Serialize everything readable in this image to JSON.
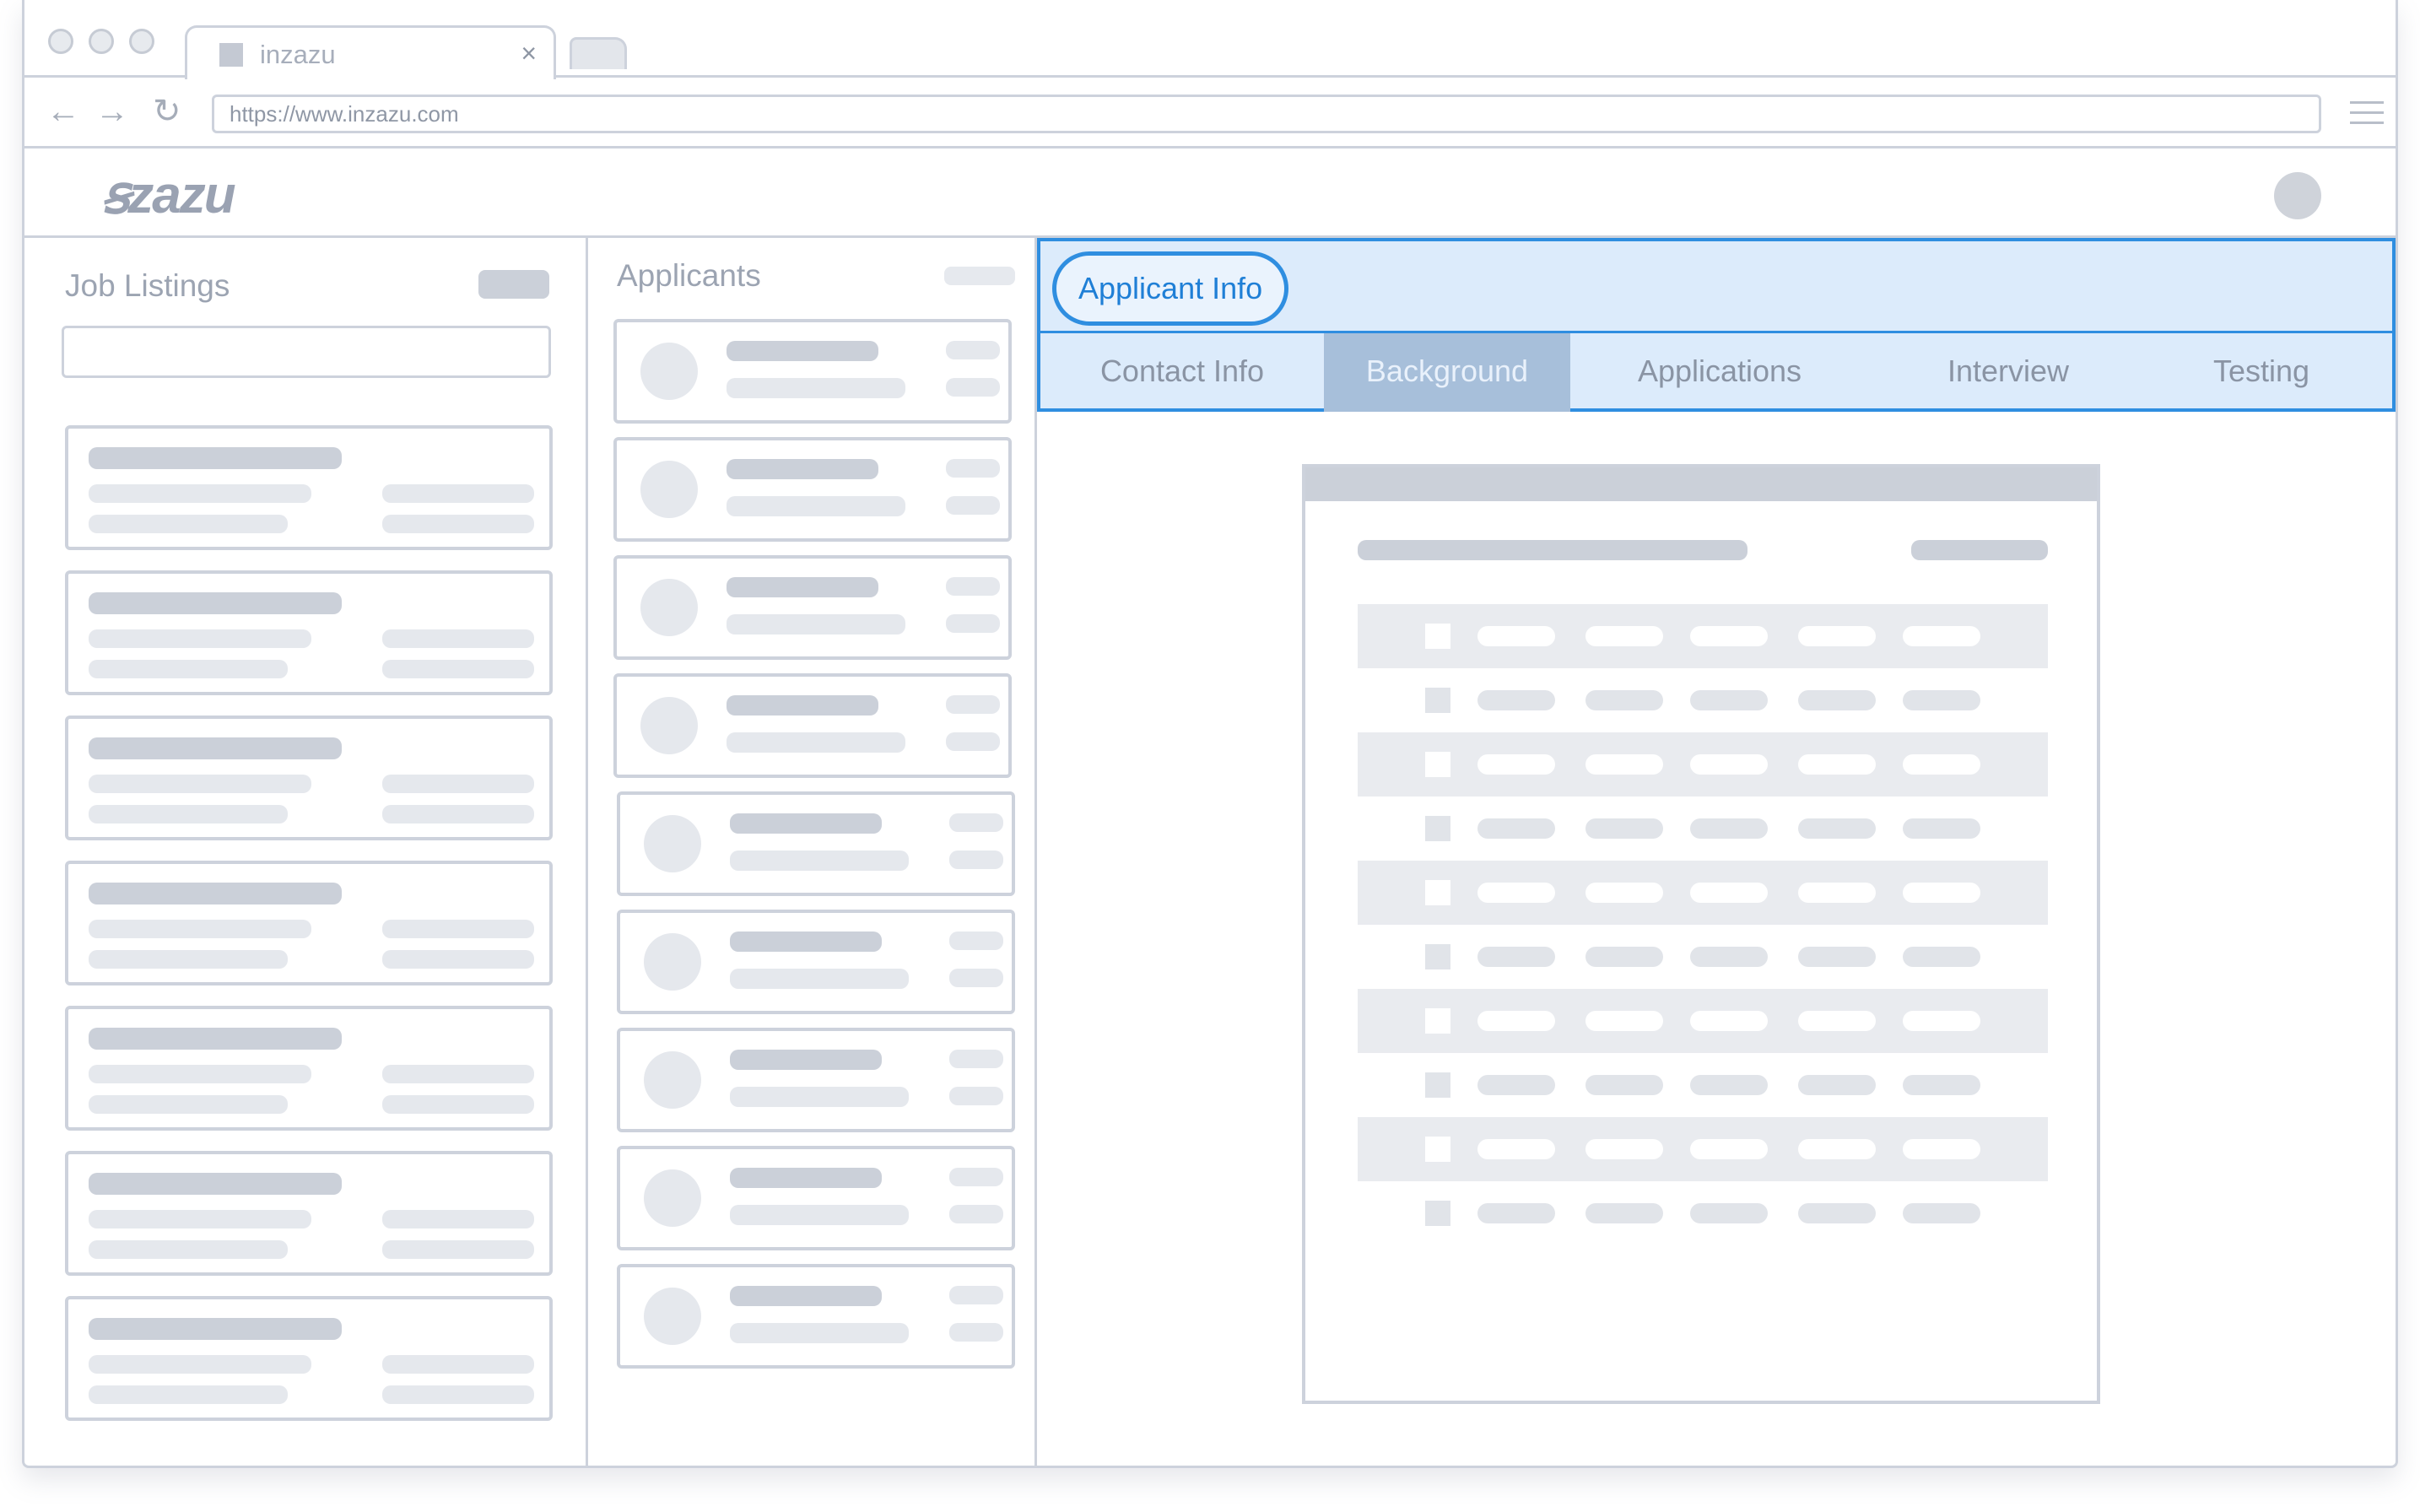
{
  "browser": {
    "tab_title": "inzazu",
    "tab_close": "×",
    "url": "https://www.inzazu.com",
    "back_glyph": "←",
    "forward_glyph": "→",
    "reload_glyph": "↻"
  },
  "app": {
    "logo": "ꞩzazu"
  },
  "jobs": {
    "title": "Job Listings",
    "card_count": 7
  },
  "applicants": {
    "title": "Applicants",
    "card_count": 9
  },
  "detail": {
    "section_button": "Applicant Info",
    "tabs": [
      {
        "label": "Contact Info",
        "active": false
      },
      {
        "label": "Background",
        "active": true
      },
      {
        "label": "Applications",
        "active": false
      },
      {
        "label": "Interview",
        "active": false
      },
      {
        "label": "Testing",
        "active": false
      }
    ]
  },
  "icons": {
    "favicon": "favicon-icon",
    "menu": "hamburger-menu-icon",
    "avatar": "user-avatar-icon"
  },
  "colors": {
    "accent": "#2f8ee0",
    "panel_bg": "#dcebfb",
    "active_tab": "#a7bfda",
    "skeleton_dark": "#cbd0d9",
    "skeleton_light": "#e5e8ed",
    "border": "#cdd2dc"
  }
}
